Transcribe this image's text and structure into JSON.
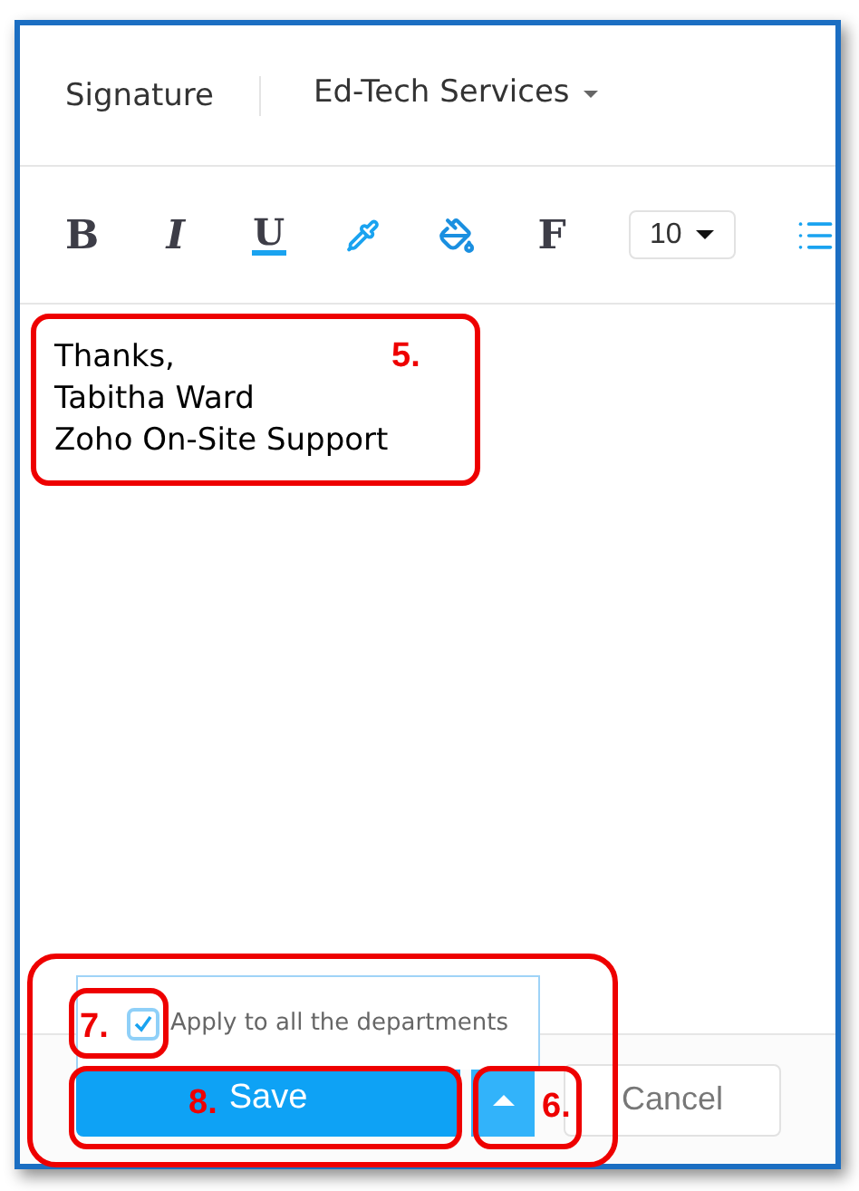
{
  "header": {
    "title": "Signature",
    "department": "Ed-Tech Services"
  },
  "toolbar": [
    {
      "kind": "bold",
      "label": "B"
    },
    {
      "kind": "italic",
      "label": "I"
    },
    {
      "kind": "underline",
      "label": "U"
    },
    {
      "kind": "text-color"
    },
    {
      "kind": "fill-color"
    },
    {
      "kind": "font",
      "label": "F"
    },
    {
      "kind": "size",
      "label": "10"
    },
    {
      "kind": "list"
    }
  ],
  "signature_lines": [
    "Thanks,",
    "Tabitha Ward",
    "Zoho On-Site Support"
  ],
  "apply_all": {
    "label": "Apply to all the departments",
    "checked": true
  },
  "buttons": {
    "save": "Save",
    "cancel": "Cancel"
  },
  "callouts": [
    {
      "label": "5."
    },
    {
      "label": "6."
    },
    {
      "label": "7."
    },
    {
      "label": "8."
    }
  ]
}
